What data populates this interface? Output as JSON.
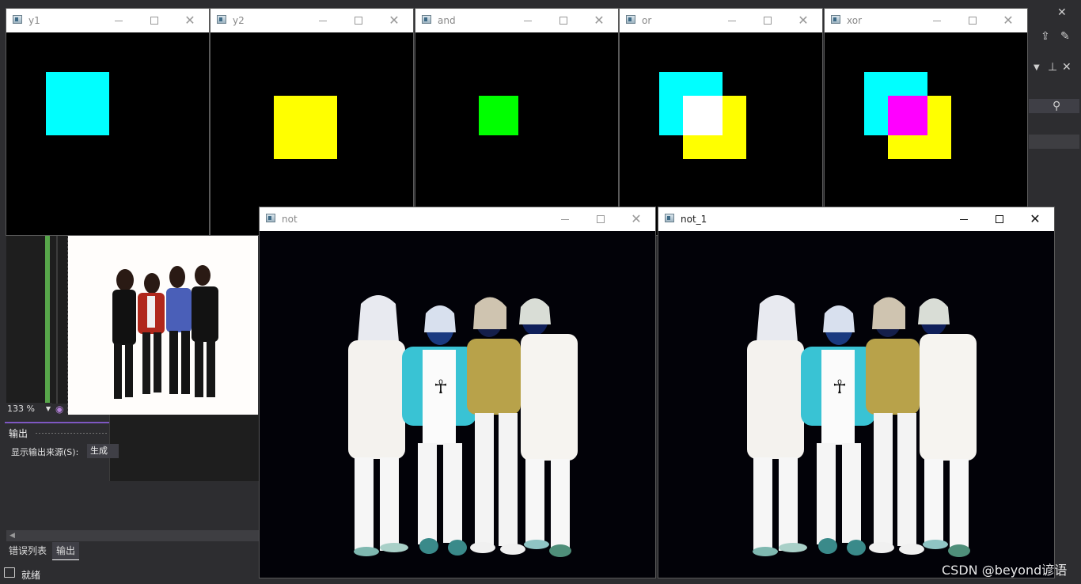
{
  "colors": {
    "cyan": "#00ffff",
    "yellow": "#ffff00",
    "green": "#00ff00",
    "white": "#ffffff",
    "magenta": "#ff00ff",
    "vs_bg": "#2d2d30",
    "vs_green_gutter": "#57a64a",
    "vs_accent": "#7e57c2"
  },
  "windows": {
    "y1": {
      "title": "y1"
    },
    "y2": {
      "title": "y2"
    },
    "and": {
      "title": "and"
    },
    "or": {
      "title": "or"
    },
    "xor": {
      "title": "xor"
    },
    "not": {
      "title": "not"
    },
    "not_1": {
      "title": "not_1"
    }
  },
  "window_controls": {
    "minimize_icon": "minimize-icon",
    "maximize_icon": "maximize-icon",
    "close_glyph": "✕"
  },
  "vs": {
    "zoom": "133 %",
    "output_panel": {
      "title": "输出",
      "source_label": "显示输出来源(S):",
      "source_value": "生成"
    },
    "bottom_tabs": [
      "错误列表",
      "输出"
    ],
    "status": "就绪",
    "right_icons": [
      "close-icon",
      "share-icon",
      "feedback-icon",
      "dropdown-icon",
      "pin-icon",
      "close-icon",
      "search-icon"
    ]
  },
  "watermark": "CSDN @beyond谚语"
}
